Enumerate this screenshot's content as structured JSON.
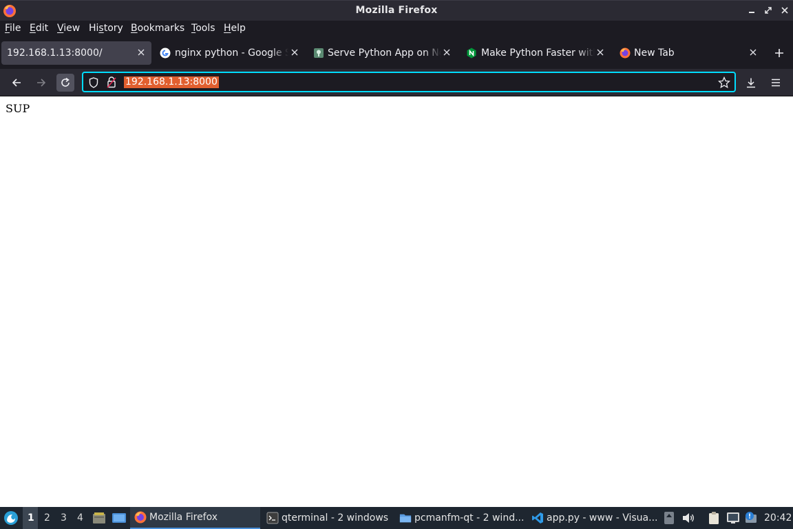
{
  "window": {
    "title": "Mozilla Firefox"
  },
  "menu": [
    "File",
    "Edit",
    "View",
    "History",
    "Bookmarks",
    "Tools",
    "Help"
  ],
  "menu_underline": [
    "F",
    "E",
    "V",
    "s",
    "B",
    "T",
    "H"
  ],
  "tabs": [
    {
      "label": "192.168.1.13:8000/",
      "favicon": "none",
      "active": true
    },
    {
      "label": "nginx python - Google Se",
      "favicon": "google-icon",
      "active": false
    },
    {
      "label": "Serve Python App on Ngi",
      "favicon": "site-icon",
      "active": false
    },
    {
      "label": "Make Python Faster with",
      "favicon": "nginx-icon",
      "active": false
    },
    {
      "label": "New Tab",
      "favicon": "firefox-icon",
      "active": false
    }
  ],
  "urlbar": {
    "value": "192.168.1.13:8000"
  },
  "page": {
    "text": "SUP"
  },
  "taskbar": {
    "workspaces": [
      "1",
      "2",
      "3",
      "4"
    ],
    "tasks": [
      {
        "label": "Mozilla Firefox",
        "icon": "firefox-icon",
        "active": true
      },
      {
        "label": "qterminal - 2 windows",
        "icon": "terminal-icon",
        "active": false
      },
      {
        "label": "pcmanfm-qt - 2 wind...",
        "icon": "folder-icon",
        "active": false
      },
      {
        "label": "app.py - www - Visua...",
        "icon": "vscode-icon",
        "active": false
      }
    ],
    "clock": "20:42"
  },
  "colors": {
    "accent": "#00ddff",
    "selection": "#e15f2f",
    "chrome": "#1c1b22",
    "active_tab": "#42414d"
  }
}
